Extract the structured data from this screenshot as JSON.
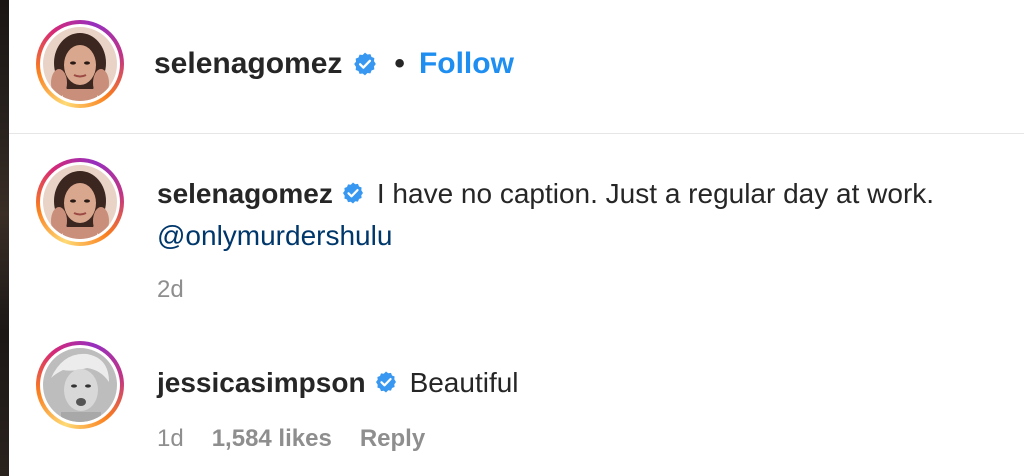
{
  "post_header": {
    "username": "selenagomez",
    "separator": "•",
    "follow_label": "Follow"
  },
  "caption": {
    "username": "selenagomez",
    "text": "I have no caption. Just a regular day at work.",
    "mention": "@onlymurdershulu",
    "timestamp": "2d"
  },
  "comment": {
    "username": "jessicasimpson",
    "text": "Beautiful",
    "timestamp": "1d",
    "likes": "1,584 likes",
    "reply_label": "Reply"
  },
  "colors": {
    "follow_blue": "#1f8ef1",
    "mention_navy": "#00376b",
    "meta_gray": "#8e8e8e",
    "verified_blue": "#3897f0"
  },
  "icons": [
    "verified-badge-icon"
  ]
}
